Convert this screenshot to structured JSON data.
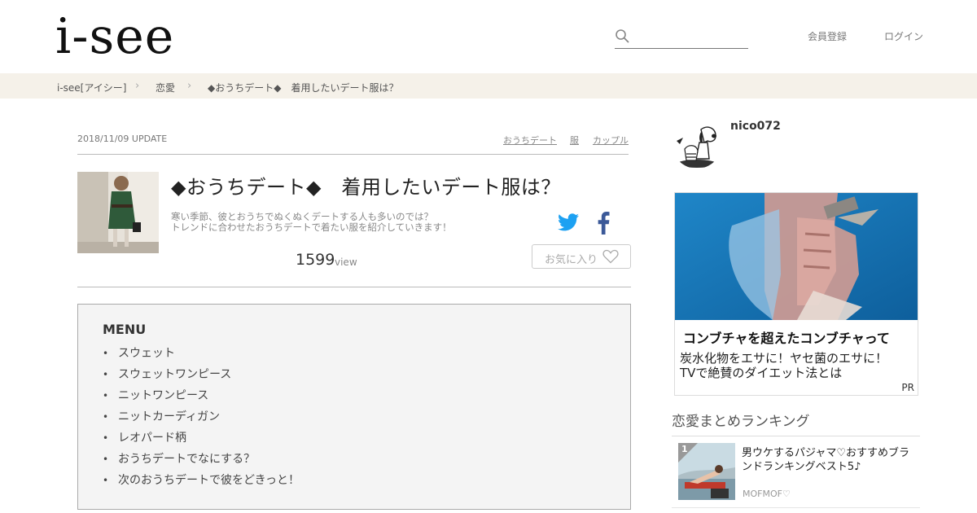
{
  "header": {
    "logo": "i-see",
    "search_placeholder": "",
    "register_label": "会員登録",
    "login_label": "ログイン"
  },
  "breadcrumb": {
    "items": [
      "i-see[アイシー]",
      "恋愛",
      "◆おうちデート◆　着用したいデート服は？"
    ],
    "separator": "›"
  },
  "article": {
    "update": "2018/11/09 UPDATE",
    "tags": [
      "おうちデート",
      "服",
      "カップル"
    ],
    "title": "◆おうちデート◆　着用したいデート服は？",
    "description": [
      "寒い季節、彼とおうちでぬくぬくデートする人も多いのでは？",
      "トレンドに合わせたおうちデートで着たい服を紹介していきます！"
    ],
    "view_count": "1599",
    "view_label": "view",
    "favorite_label": "お気に入り"
  },
  "menu": {
    "title": "MENU",
    "items": [
      "スウェット",
      "スウェットワンピース",
      "ニットワンピース",
      "ニットカーディガン",
      "レオパード柄",
      "おうちデートでなにする？",
      "次のおうちデートで彼をどきっと！"
    ]
  },
  "sidebar": {
    "username": "nico072",
    "ad": {
      "headline": "コンブチャを超えたコンブチャって",
      "body": [
        "炭水化物をエサに！ヤセ菌のエサに！",
        "TVで絶賛のダイエット法とは"
      ],
      "pr": "PR"
    },
    "ranking": {
      "title": "恋愛まとめランキング",
      "items": [
        {
          "rank": "1",
          "title": "男ウケするパジャマ♡おすすめブランドランキングベスト5♪",
          "author": "MOFMOF♡"
        }
      ]
    }
  },
  "colors": {
    "breadcrumb_bg": "#f5f1e9",
    "twitter": "#1da1f2",
    "facebook": "#3b5998",
    "menu_bg": "#f4f4f4"
  }
}
